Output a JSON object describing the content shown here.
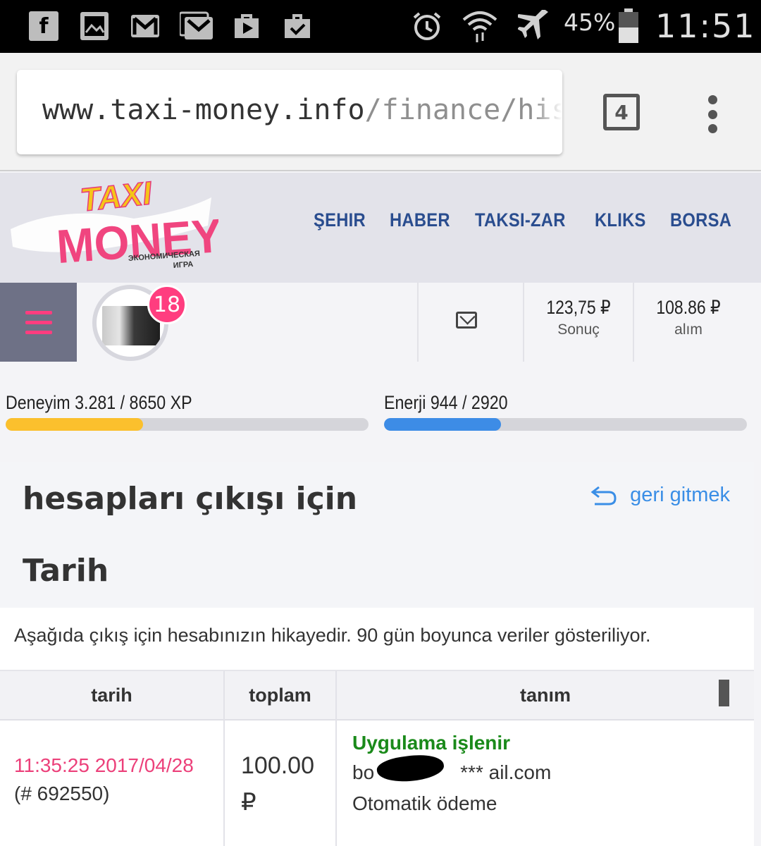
{
  "statusbar": {
    "notification_icons": [
      "facebook-icon",
      "gallery-icon",
      "gmail-icon",
      "gmail-stack-icon",
      "play-store-icon",
      "briefcase-check-icon"
    ],
    "battery": "45%",
    "time": "11:51"
  },
  "browser": {
    "url_host": "www.taxi-money.info",
    "url_path": "/finance/histo",
    "tab_count": "4"
  },
  "site": {
    "logo": {
      "line1": "TAXI",
      "line2": "MONEY",
      "tagline1": "ЭКОНОМИЧЕСКАЯ",
      "tagline2": "ИГРА"
    },
    "nav": [
      "ŞEHIR",
      "HABER",
      "TAKSI-ZAR",
      "KLIKS",
      "BORSA"
    ]
  },
  "user": {
    "notification_count": "18",
    "balance_value": "123,75 ₽",
    "balance_label": "Sonuç",
    "purchase_value": "108.86 ₽",
    "purchase_label": "alım"
  },
  "progress": {
    "experience": {
      "label": "Deneyim 3.281 / 8650 XP",
      "fraction": 0.379,
      "color": "#fbc02d"
    },
    "energy": {
      "label": "Enerji 944 / 2920",
      "fraction": 0.323,
      "color": "#3d8ce6"
    }
  },
  "page": {
    "title": "hesapları çıkışı için",
    "back_label": "geri gitmek",
    "subtitle": "Tarih",
    "description": "Aşağıda çıkış için hesabınızın hikayedir. 90 gün boyunca veriler gösteriliyor."
  },
  "table": {
    "headers": [
      "tarih",
      "toplam",
      "tanım"
    ],
    "rows": [
      {
        "datetime": "11:35:25 2017/04/28",
        "id": "(# 692550)",
        "amount": "100.00",
        "currency": "₽",
        "status": "Uygulama işlenir",
        "email_start": "bo",
        "email_end": "*** ail.com",
        "payment_type": "Otomatik ödeme"
      }
    ]
  }
}
